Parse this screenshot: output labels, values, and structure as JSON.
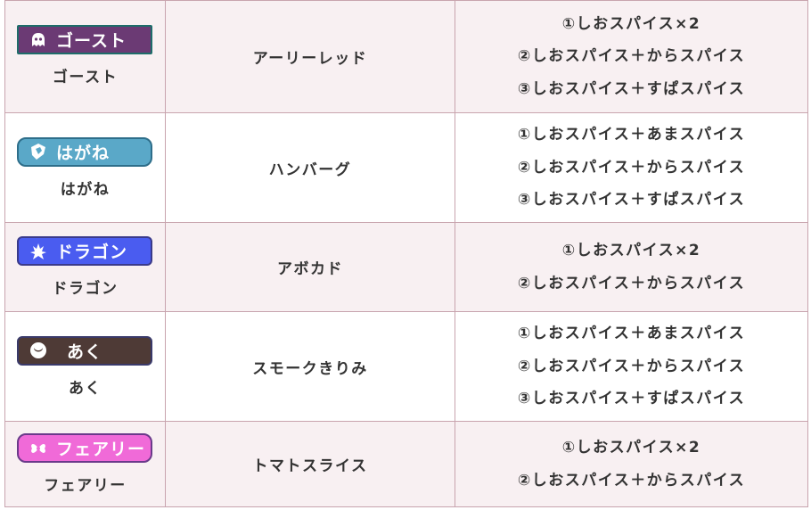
{
  "rows": [
    {
      "badge_label": "ゴースト",
      "badge_color": "#6b3a74",
      "badge_border": "#1e6d6a",
      "icon": "ghost-icon",
      "type": "ゴースト",
      "ingredient": "アーリーレッド",
      "spices": [
        "①しおスパイス×2",
        "②しおスパイス＋からスパイス",
        "③しおスパイス＋すぱスパイス"
      ]
    },
    {
      "badge_label": "はがね",
      "badge_color": "#5aa8c8",
      "badge_border": "#2e6e8a",
      "icon": "steel-icon",
      "type": "はがね",
      "ingredient": "ハンバーグ",
      "spices": [
        "①しおスパイス＋あまスパイス",
        "②しおスパイス＋からスパイス",
        "③しおスパイス＋すぱスパイス"
      ]
    },
    {
      "badge_label": "ドラゴン",
      "badge_color": "#4a5cf0",
      "badge_border": "#3a3a8a",
      "icon": "dragon-icon",
      "type": "ドラゴン",
      "ingredient": "アボカド",
      "spices": [
        "①しおスパイス×2",
        "②しおスパイス＋からスパイス"
      ]
    },
    {
      "badge_label": "あく",
      "badge_color": "#4e3a36",
      "badge_border": "#3a3a6a",
      "icon": "dark-icon",
      "type": "あく",
      "ingredient": "スモークきりみ",
      "spices": [
        "①しおスパイス＋あまスパイス",
        "②しおスパイス＋からスパイス",
        "③しおスパイス＋すぱスパイス"
      ]
    },
    {
      "badge_label": "フェアリー",
      "badge_color": "#f06ad8",
      "badge_border": "#6a3a8a",
      "icon": "fairy-icon",
      "type": "フェアリー",
      "ingredient": "トマトスライス",
      "spices": [
        "①しおスパイス×2",
        "②しおスパイス＋からスパイス"
      ]
    }
  ]
}
